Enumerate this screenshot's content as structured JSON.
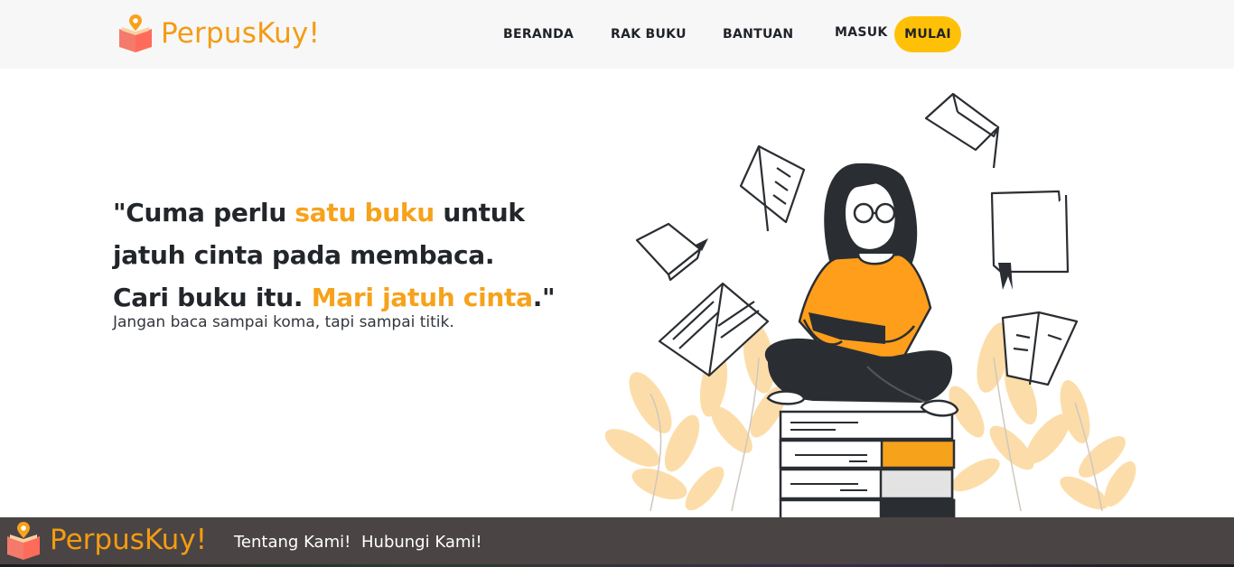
{
  "navbar": {
    "brand_name": "PerpusKuy!",
    "logo_icon": "book-logo-icon",
    "links": {
      "beranda": "BERANDA",
      "rak_buku": "RAK BUKU",
      "bantuan": "BANTUAN",
      "masuk": "MASUK"
    },
    "cta_label": "MULAI"
  },
  "hero": {
    "line1_a": "\"Cuma perlu ",
    "line1_hl": "satu buku",
    "line1_b": " untuk",
    "line2": "jatuh cinta pada membaca.",
    "line3_a": "Cari buku itu. ",
    "line3_hl": "Mari jatuh cinta",
    "line3_b": ".\"",
    "subtitle": "Jangan baca sampai koma, tapi sampai titik."
  },
  "illustration": {
    "icon": "girl-reading-books-illustration"
  },
  "footer": {
    "brand_name": "PerpusKuy!",
    "links": [
      "Tentang Kami!",
      "Hubungi Kami!"
    ]
  },
  "colors": {
    "accent": "#f39c12",
    "highlight": "#f7a21b",
    "cta": "#ffc107",
    "navbar_bg": "#f7f7f8",
    "footer_bg": "#4a4444"
  }
}
